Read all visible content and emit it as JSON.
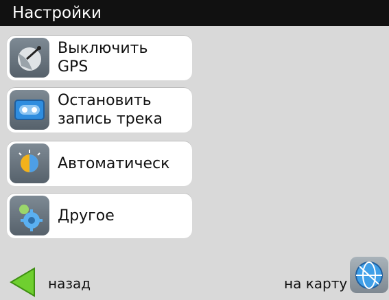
{
  "title": "Настройки",
  "menu": [
    {
      "label_line1": "Выключить",
      "label_line2": "GPS",
      "icon": "satellite-dish-icon"
    },
    {
      "label_line1": "Остановить",
      "label_line2": "запись трека",
      "icon": "cassette-tape-icon"
    },
    {
      "label_line1": "Автоматическ",
      "label_line2": "",
      "icon": "day-night-icon"
    },
    {
      "label_line1": "Другое",
      "label_line2": "",
      "icon": "gears-icon"
    }
  ],
  "footer": {
    "back_label": "назад",
    "map_label": "на карту"
  },
  "colors": {
    "title_bar": "#111111",
    "background": "#d9d9d9",
    "item_bg": "#ffffff",
    "back_arrow": "#6fcf2f",
    "globe": "#2f8ddf"
  }
}
